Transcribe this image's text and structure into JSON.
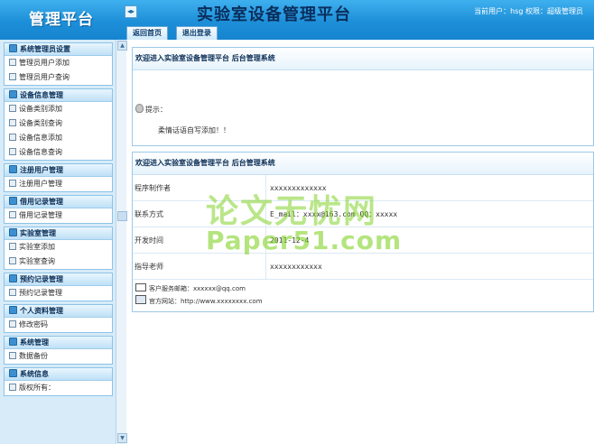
{
  "brand": "管理平台",
  "system_title": "实验室设备管理平台",
  "user_info": "当前用户：hsg 权限：超级管理员",
  "toggle_symbol": "◂▸",
  "tabs": [
    {
      "label": "返回首页"
    },
    {
      "label": "退出登录"
    }
  ],
  "sidebar": {
    "groups": [
      {
        "title": "系统管理员设置",
        "items": [
          "管理员用户添加",
          "管理员用户查询"
        ]
      },
      {
        "title": "设备信息管理",
        "items": [
          "设备类别添加",
          "设备类别查询",
          "设备信息添加",
          "设备信息查询"
        ]
      },
      {
        "title": "注册用户管理",
        "items": [
          "注册用户管理"
        ]
      },
      {
        "title": "借用记录管理",
        "items": [
          "借用记录管理"
        ]
      },
      {
        "title": "实验室管理",
        "items": [
          "实验室添加",
          "实验室查询"
        ]
      },
      {
        "title": "预约记录管理",
        "items": [
          "预约记录管理"
        ]
      },
      {
        "title": "个人资料管理",
        "items": [
          "修改密码"
        ]
      },
      {
        "title": "系统管理",
        "items": [
          "数据备份"
        ]
      },
      {
        "title": "系统信息",
        "items": [
          "版权所有："
        ]
      }
    ]
  },
  "welcome_panel": {
    "heading": "欢迎进入实验室设备管理平台 后台管理系统",
    "tip_label": "提示：",
    "tip_message": "柔情话语自写添加！！"
  },
  "info_panel": {
    "heading": "欢迎进入实验室设备管理平台 后台管理系统",
    "rows": [
      {
        "key": "程序制作者",
        "value": "xxxxxxxxxxxxx"
      },
      {
        "key": "联系方式",
        "value": "E_mail：xxxx@163.com QQ：xxxxx"
      },
      {
        "key": "开发时间",
        "value": "2011-12-4"
      },
      {
        "key": "指导老师",
        "value": "xxxxxxxxxxxx"
      }
    ],
    "service_email": "客户服务邮箱：xxxxxx@qq.com",
    "website": "官方网站：http://www.xxxxxxxx.com"
  },
  "watermark": {
    "line1": "论文无忧网",
    "line2": "Paper51.com"
  },
  "colors": {
    "topbar": "#1d8fd8",
    "sidebar_bg": "#d7ebf8",
    "watermark": "#82d228"
  }
}
